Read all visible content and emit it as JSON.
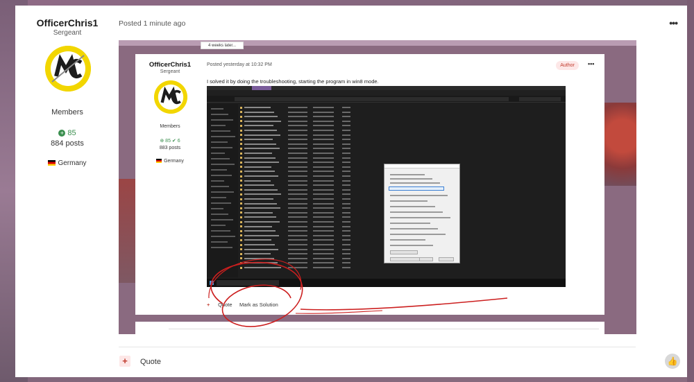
{
  "post": {
    "author": {
      "name": "OfficerChris1",
      "rank": "Sergeant",
      "group": "Members",
      "reputation": "85",
      "posts": "884 posts",
      "country": "Germany"
    },
    "meta": "Posted 1 minute ago",
    "more_label": "•••",
    "actions": {
      "quote_label": "Quote"
    }
  },
  "quoted_screenshot": {
    "weeks_later": "4 weeks later...",
    "author": {
      "name": "OfficerChris1",
      "rank": "Sergeant",
      "group": "Members",
      "reputation": "85",
      "likes": "6",
      "posts": "883 posts",
      "country": "Germany"
    },
    "meta": "Posted yesterday at 10:32 PM",
    "author_badge": "Author",
    "body_text": "I solved it by doing the troubleshooting, starting the program in win8 mode.",
    "actions": {
      "quote_label": "Quote",
      "solution_label": "Mark as Solution"
    }
  },
  "colors": {
    "accent_red": "#c0392b",
    "reputation_green": "#3b8f4f",
    "annotation_red": "#cc1f1f"
  },
  "icons": {
    "more": "ellipsis-icon",
    "quote": "plus-icon",
    "like": "thumbs-up-icon",
    "reputation": "plus-circle-icon",
    "country": "germany-flag-icon"
  }
}
